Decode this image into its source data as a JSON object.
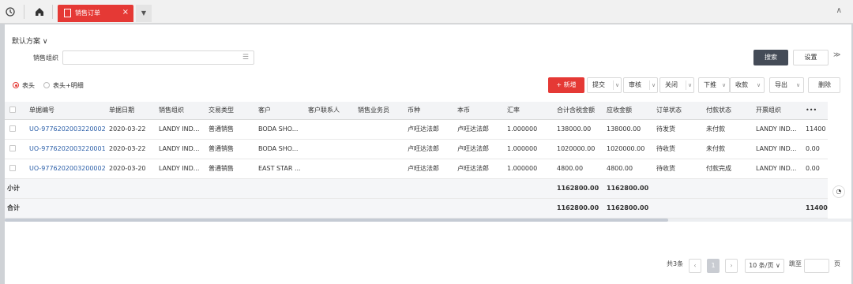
{
  "tabs": {
    "active_label": "销售订单"
  },
  "filter": {
    "scheme": "默认方案 ∨",
    "org_label": "销售组织",
    "org_value": "",
    "search_label": "搜索",
    "settings_label": "设置"
  },
  "view": {
    "radio1": "表头",
    "radio2": "表头+明细"
  },
  "actions": {
    "new": "+ 新增",
    "submit": "提交",
    "audit": "审核",
    "close": "关闭",
    "push": "下推",
    "receipt": "收款",
    "export": "导出",
    "delete": "删除"
  },
  "table": {
    "columns": [
      "单据编号",
      "单据日期",
      "销售组织",
      "交易类型",
      "客户",
      "客户联系人",
      "销售业务员",
      "币种",
      "本币",
      "汇率",
      "合计含税金额",
      "应收金额",
      "订单状态",
      "付款状态",
      "开票组织",
      "•••"
    ],
    "rows": [
      [
        "UO-9776202003220002",
        "2020-03-22",
        "LANDY IND...",
        "普通销售",
        "BODA SHO...",
        "",
        "",
        "卢旺达法郎",
        "卢旺达法郎",
        "1.000000",
        "138000.00",
        "138000.00",
        "待发货",
        "未付款",
        "LANDY IND...",
        "11400"
      ],
      [
        "UO-9776202003220001",
        "2020-03-22",
        "LANDY IND...",
        "普通销售",
        "BODA SHO...",
        "",
        "",
        "卢旺达法郎",
        "卢旺达法郎",
        "1.000000",
        "1020000.00",
        "1020000.00",
        "待收货",
        "未付款",
        "LANDY IND...",
        "0.00"
      ],
      [
        "UO-9776202003200002",
        "2020-03-20",
        "LANDY IND...",
        "普通销售",
        "EAST STAR ...",
        "",
        "",
        "卢旺达法郎",
        "卢旺达法郎",
        "1.000000",
        "4800.00",
        "4800.00",
        "待收货",
        "付款完成",
        "LANDY IND...",
        "0.00"
      ]
    ],
    "subtotal_label": "小计",
    "subtotal_amount": "1162800.00",
    "subtotal_receivable": "1162800.00",
    "total_label": "合计",
    "total_amount": "1162800.00",
    "total_receivable": "1162800.00",
    "total_extra": "11400"
  },
  "pager": {
    "total": "共3条",
    "page": "1",
    "size": "10 条/页",
    "goto": "跳至",
    "unit": "页"
  },
  "colors": {
    "accent": "#e53935",
    "dark": "#444b57",
    "link": "#2a5ea8"
  }
}
